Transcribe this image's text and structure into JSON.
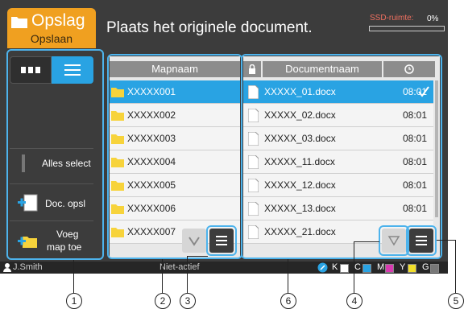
{
  "header": {
    "mode_title": "Opslag",
    "mode_subtitle": "Opslaan",
    "message": "Plaats het originele document.",
    "ssd_label": "SSD-ruimte:",
    "ssd_value": "0%"
  },
  "sidebar": {
    "select_all": "Alles select",
    "doc_save": "Doc. opsl",
    "add_folder_line1": "Voeg",
    "add_folder_line2": "map toe"
  },
  "folders": {
    "header": "Mapnaam",
    "items": [
      "XXXXX001",
      "XXXXX002",
      "XXXXX003",
      "XXXXX004",
      "XXXXX005",
      "XXXXX006",
      "XXXXX007"
    ]
  },
  "documents": {
    "header": "Documentnaam",
    "items": [
      {
        "name": "XXXXX_01.docx",
        "time": "08:01"
      },
      {
        "name": "XXXXX_02.docx",
        "time": "08:01"
      },
      {
        "name": "XXXXX_03.docx",
        "time": "08:01"
      },
      {
        "name": "XXXXX_11.docx",
        "time": "08:01"
      },
      {
        "name": "XXXXX_12.docx",
        "time": "08:01"
      },
      {
        "name": "XXXXX_13.docx",
        "time": "08:01"
      },
      {
        "name": "XXXXX_21.docx",
        "time": ""
      }
    ]
  },
  "status": {
    "user": "J.Smith",
    "state": "Niet-actief",
    "inks": [
      "K",
      "C",
      "M",
      "Y",
      "G"
    ]
  },
  "colors": {
    "accent": "#29a3e3",
    "mode": "#f0a020",
    "callout_border": "#4db3ec"
  },
  "callouts": [
    "1",
    "2",
    "3",
    "6",
    "4",
    "5"
  ]
}
